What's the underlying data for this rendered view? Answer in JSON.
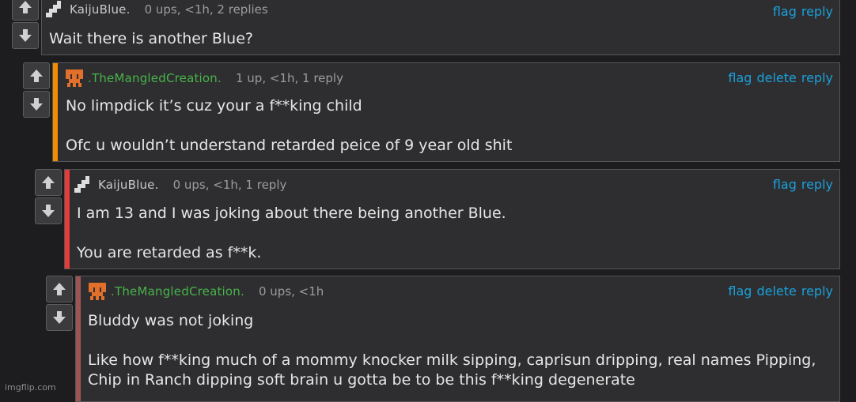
{
  "icons": {
    "upvote": "arrow-up-icon",
    "downvote": "arrow-down-icon"
  },
  "colors": {
    "link": "#1aa1db",
    "green_user": "#48b34a",
    "bar_orange": "#f28c00",
    "bar_red": "#e53b3b",
    "bar_rose": "#9b5555"
  },
  "comments": [
    {
      "username": "KaijuBlue.",
      "meta": "0 ups, <1h, 2 replies",
      "actions": [
        "flag",
        "reply"
      ],
      "lines": [
        "Wait there is another Blue?"
      ]
    },
    {
      "username": ".TheMangledCreation.",
      "meta": "1 up, <1h, 1 reply",
      "actions": [
        "flag",
        "delete",
        "reply"
      ],
      "lines": [
        "No limpdick it’s cuz your a f**king child",
        "Ofc u wouldn’t understand retarded peice of 9 year old shit"
      ]
    },
    {
      "username": "KaijuBlue.",
      "meta": "0 ups, <1h, 1 reply",
      "actions": [
        "flag",
        "reply"
      ],
      "lines": [
        "I am 13 and I was joking about there being another Blue.",
        "You are retarded as f**k."
      ]
    },
    {
      "username": ".TheMangledCreation.",
      "meta": "0 ups, <1h",
      "actions": [
        "flag",
        "delete",
        "reply"
      ],
      "lines": [
        "Bluddy was not joking",
        "Like how f**king much of a mommy knocker milk sipping, caprisun dripping, real names Pipping,",
        "Chip in Ranch dipping soft brain u gotta be to be this f**king degenerate"
      ]
    }
  ],
  "watermark": "imgflip.com"
}
